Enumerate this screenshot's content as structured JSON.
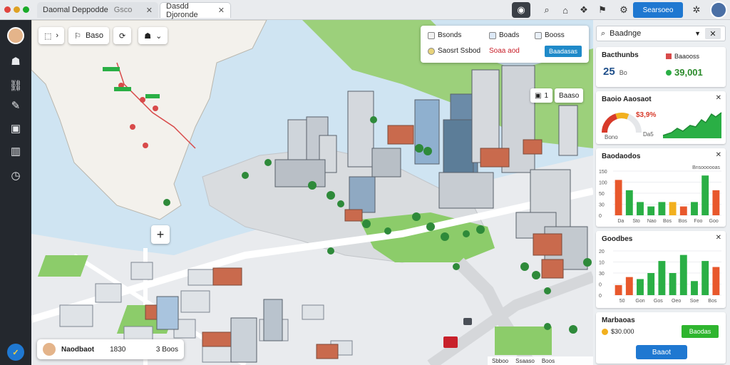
{
  "window": {
    "tabs": [
      {
        "label": "Daomal Deppodde"
      },
      {
        "label": "Dasdd Djoronde"
      }
    ],
    "location_text": "Gsco"
  },
  "toolbar_right": {
    "primary_button": "Searsoeo"
  },
  "map": {
    "toolbar": {
      "btn_label": "Baso"
    },
    "legend": {
      "items": [
        {
          "label": "Bsonds",
          "color": "#f2f2f2"
        },
        {
          "label": "Boads",
          "color": "#dde9f7"
        },
        {
          "label": "Booss",
          "color": "#e9f0f8"
        },
        {
          "label": "Saosrt Ssbod",
          "color": "#e8d37a"
        },
        {
          "label": "Soaa aod",
          "color": "#ffffff"
        }
      ],
      "apply_button": "Baadasas"
    },
    "zoom_in": "+",
    "layer_buttons": [
      "1",
      "Baaso"
    ],
    "bottom_card": {
      "name": "Naodbaot",
      "value": "1830",
      "count": "3 Boos"
    },
    "scale": [
      "Sbboo",
      "Ssaaso",
      "Boos"
    ]
  },
  "panel": {
    "search": {
      "value": "Baadnge"
    },
    "stats_card": {
      "title": "Bacthunbs",
      "big_value": "25",
      "big_unit": "Bo",
      "secondary_title": "Baaooss",
      "secondary_value": "39,001"
    },
    "gauge_card": {
      "title": "Baoio Aaosaot",
      "gauge_value": "$3,9%",
      "gauge_caption": "Bono",
      "small_label": "Da5",
      "gauge_fraction": 0.62
    },
    "chart1": {
      "title": "Baodaodos",
      "chart_data": {
        "type": "bar",
        "categories": [
          "1",
          "2",
          "3",
          "4",
          "5",
          "6",
          "7",
          "8",
          "9",
          "10"
        ],
        "values": [
          120,
          85,
          45,
          30,
          45,
          45,
          30,
          45,
          135,
          85
        ],
        "colors": [
          "#e8582c",
          "#2aaf45",
          "#2aaf45",
          "#2aaf45",
          "#2aaf45",
          "#f2b01e",
          "#e8582c",
          "#2aaf45",
          "#2aaf45",
          "#e8582c"
        ],
        "ylim": [
          0,
          150
        ],
        "yticks": [
          "150",
          "100",
          "50",
          "30",
          "0"
        ],
        "xticks": [
          "Da",
          "Sto",
          "Nao",
          "Bos",
          "Bos",
          "Foo",
          "Goo"
        ],
        "legend_text": "Bnsoooooas"
      }
    },
    "chart2": {
      "title": "Goodbes",
      "chart_data": {
        "type": "bar",
        "categories": [
          "1",
          "2",
          "3",
          "4",
          "5",
          "6",
          "7",
          "8",
          "9",
          "10"
        ],
        "values": [
          5,
          9,
          8,
          11,
          17,
          11,
          20,
          7,
          17,
          14
        ],
        "colors": [
          "#e8582c",
          "#e8582c",
          "#2aaf45",
          "#2aaf45",
          "#2aaf45",
          "#2aaf45",
          "#2aaf45",
          "#2aaf45",
          "#2aaf45",
          "#e8582c"
        ],
        "ylim": [
          0,
          22
        ],
        "yticks": [
          "20",
          "10",
          "30",
          "0",
          "0"
        ],
        "xticks": [
          "50",
          "Gon",
          "Gos",
          "Oeo",
          "Soe",
          "Bos"
        ]
      }
    },
    "actions_card": {
      "title": "Marbaoas",
      "value": "$30.000",
      "green_button": "Baodas",
      "blue_button": "Baaot"
    }
  }
}
